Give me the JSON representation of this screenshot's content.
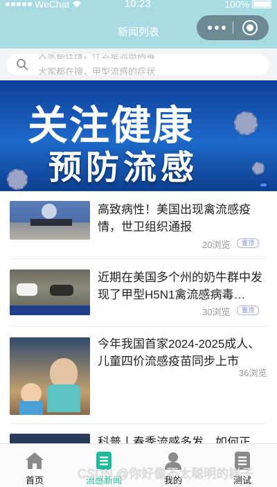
{
  "status_bar": {
    "carrier": "WeChat",
    "time": "10:23",
    "battery": "100%"
  },
  "nav": {
    "title": "新闻列表"
  },
  "search": {
    "marquee_lines": [
      "大家都在搜，什么是流感病毒",
      "大家都在搜，甲型流感的症状"
    ]
  },
  "banner": {
    "line1": "关注健康",
    "line2": "预防流感"
  },
  "news": [
    {
      "title": "高致病性！美国出现禽流感疫情，世卫组织通报",
      "views": "20浏览",
      "tag": "置顶"
    },
    {
      "title": "近期在美国多个州的奶牛群中发现了甲型H5N1禽流感病毒…",
      "views": "30浏览",
      "tag": "置顶"
    },
    {
      "title": "今年我国首家2024-2025成人、儿童四价流感疫苗同步上市",
      "views": "36浏览",
      "tag": ""
    },
    {
      "title": "科普丨春季流感多发，如何正",
      "views": "",
      "tag": ""
    }
  ],
  "tabs": [
    {
      "label": "首页",
      "icon": "home-icon"
    },
    {
      "label": "流感新闻",
      "icon": "news-icon"
    },
    {
      "label": "我的",
      "icon": "user-icon"
    },
    {
      "label": "测试",
      "icon": "test-icon"
    }
  ],
  "colors": {
    "nav_bg": "#a9dbe3",
    "active_tab": "#1fba9c",
    "tag_color": "#7b8bd6"
  },
  "watermark": "CSDN @你好像不太聪明的样子"
}
